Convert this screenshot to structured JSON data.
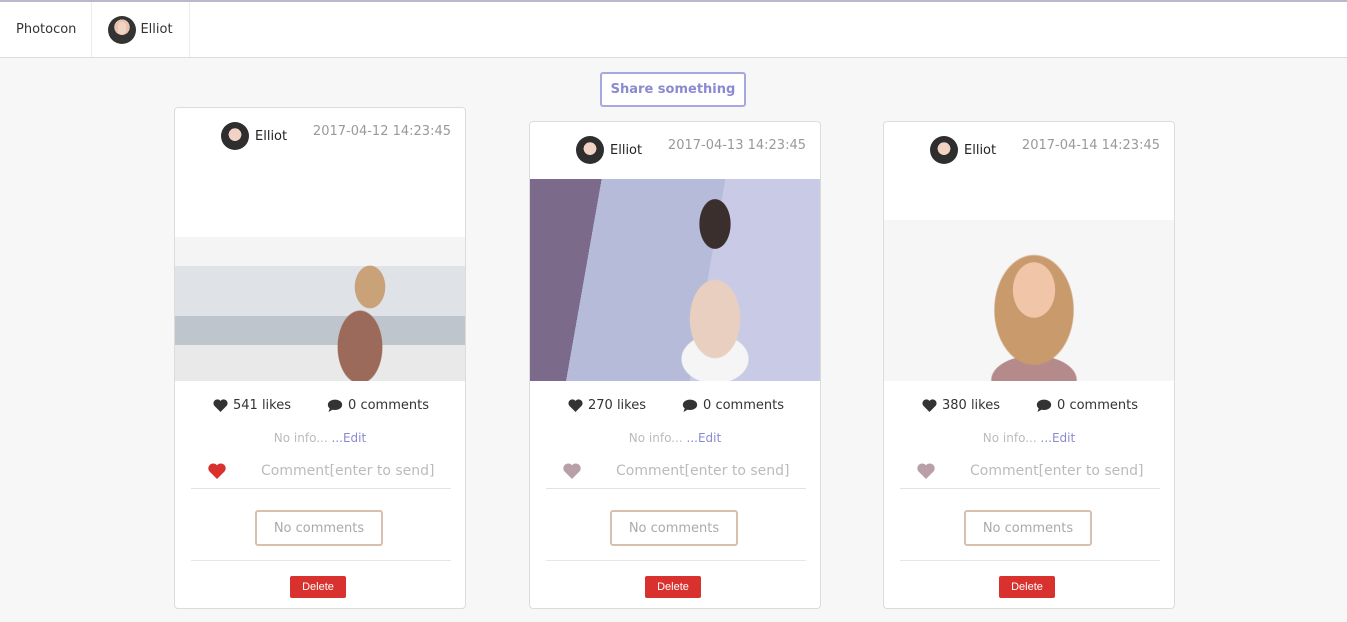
{
  "header": {
    "brand": "Photocon",
    "user_name": "Elliot"
  },
  "share_label": "Share something",
  "posts": [
    {
      "author": "Elliot",
      "timestamp": "2017-04-12 14:23:45",
      "likes": "541 likes",
      "comments": "0 comments",
      "info": "No info...",
      "edit": "...Edit",
      "comment_placeholder": "Comment[enter to send]",
      "liked": true,
      "no_comments_label": "No comments",
      "delete_label": "Delete"
    },
    {
      "author": "Elliot",
      "timestamp": "2017-04-13 14:23:45",
      "likes": "270 likes",
      "comments": "0 comments",
      "info": "No info...",
      "edit": "...Edit",
      "comment_placeholder": "Comment[enter to send]",
      "liked": false,
      "no_comments_label": "No comments",
      "delete_label": "Delete"
    },
    {
      "author": "Elliot",
      "timestamp": "2017-04-14 14:23:45",
      "likes": "380 likes",
      "comments": "0 comments",
      "info": "No info...",
      "edit": "...Edit",
      "comment_placeholder": "Comment[enter to send]",
      "liked": false,
      "no_comments_label": "No comments",
      "delete_label": "Delete"
    }
  ],
  "colors": {
    "accent": "#8a8ad0",
    "liked_heart": "#d9322e",
    "unliked_heart": "#b9a0a8",
    "delete": "#d9322e"
  }
}
